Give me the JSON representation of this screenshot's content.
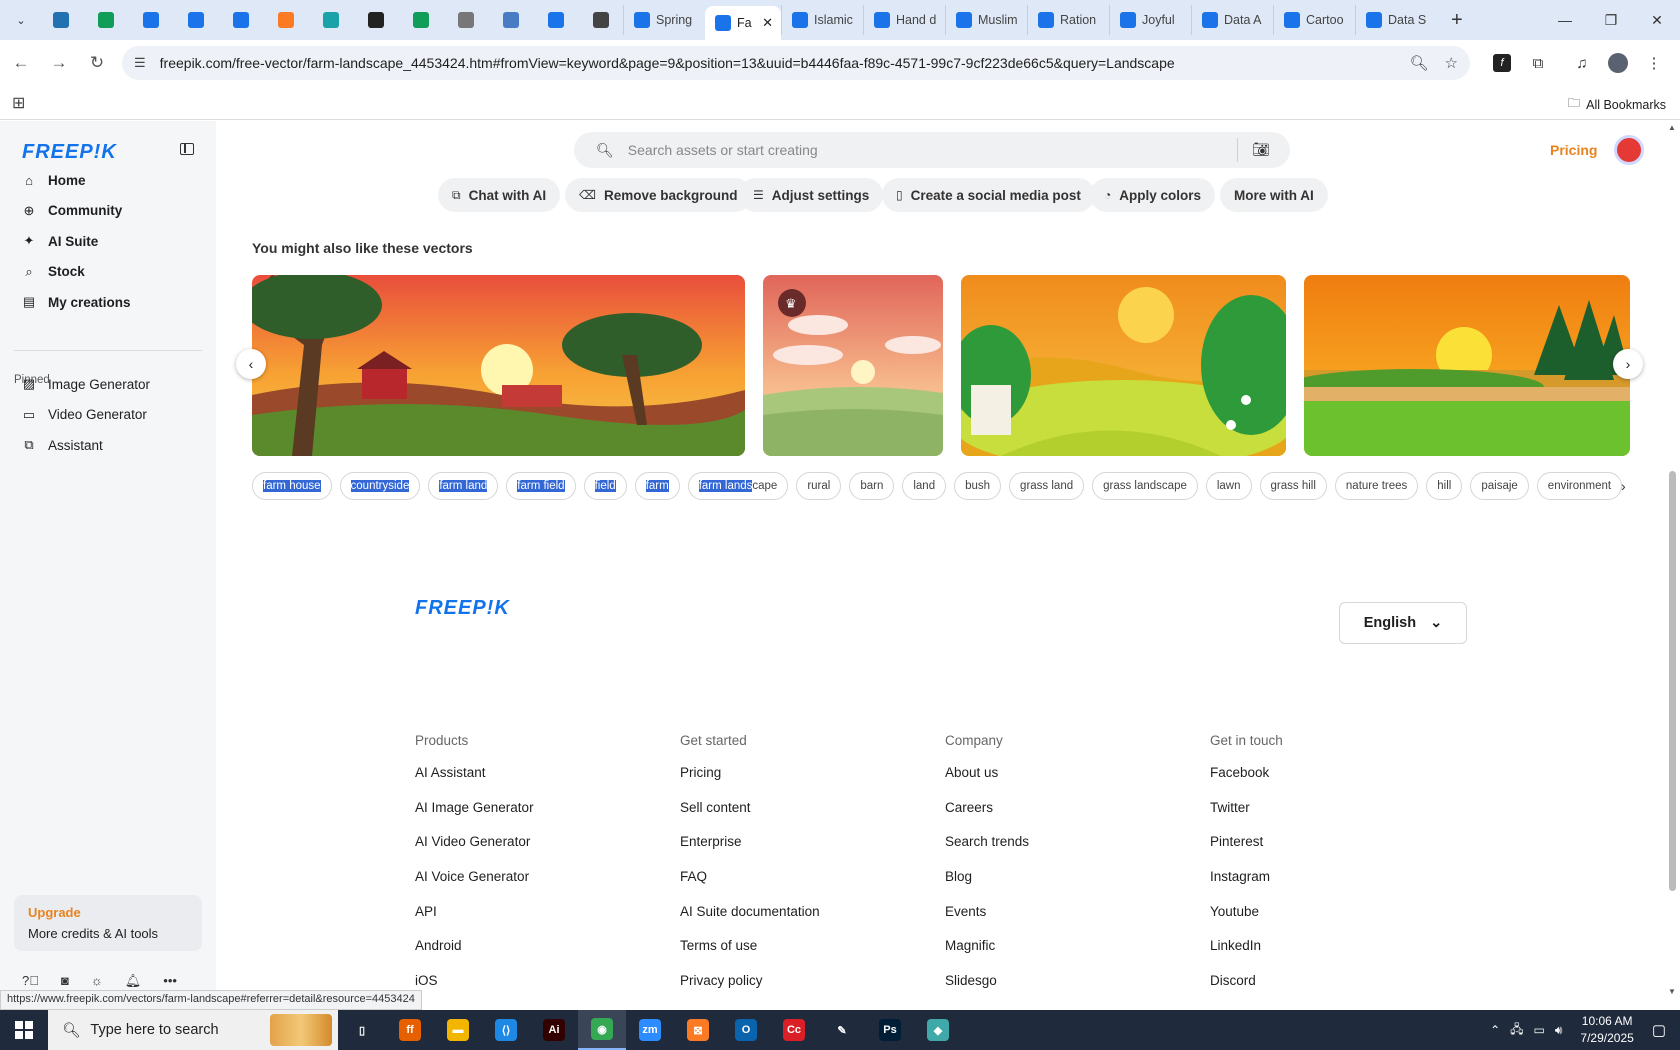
{
  "browser": {
    "pinned_tabs": [
      {
        "icon": "chevron-down-icon"
      },
      {
        "icon": "wordpress-icon",
        "color": "#2271b1"
      },
      {
        "icon": "sheets-icon",
        "color": "#0f9d58"
      },
      {
        "icon": "docs-icon",
        "color": "#1a73e8"
      },
      {
        "icon": "docs-icon",
        "color": "#1a73e8"
      },
      {
        "icon": "docs-icon",
        "color": "#1a73e8"
      },
      {
        "icon": "xampp-icon",
        "color": "#fb7a24"
      },
      {
        "icon": "teal-app-icon",
        "color": "#1aa2a8"
      },
      {
        "icon": "chatgpt-icon",
        "color": "#222222"
      },
      {
        "icon": "sheets-icon",
        "color": "#0f9d58"
      },
      {
        "icon": "globe-icon",
        "color": "#777777"
      },
      {
        "icon": "grid-app-icon",
        "color": "#4a7cc4"
      },
      {
        "icon": "docs-icon",
        "color": "#1a73e8"
      },
      {
        "icon": "speaker-icon",
        "color": "#444444"
      }
    ],
    "tabs": [
      {
        "label": "Spring",
        "active": false
      },
      {
        "label": "Fa",
        "active": true
      },
      {
        "label": "Islamic",
        "active": false
      },
      {
        "label": "Hand d",
        "active": false
      },
      {
        "label": "Muslim",
        "active": false
      },
      {
        "label": "Ration",
        "active": false
      },
      {
        "label": "Joyful",
        "active": false
      },
      {
        "label": "Data A",
        "active": false
      },
      {
        "label": "Cartoo",
        "active": false
      },
      {
        "label": "Data S",
        "active": false
      }
    ],
    "url": "freepik.com/free-vector/farm-landscape_4453424.htm#fromView=keyword&page=9&position=13&uuid=b4446faa-f89c-4571-99c7-9cf223de66c5&query=Landscape",
    "all_bookmarks": "All Bookmarks",
    "status_url": "https://www.freepik.com/vectors/farm-landscape#referrer=detail&resource=4453424"
  },
  "sidebar": {
    "logo": "FREEP!K",
    "items": [
      {
        "label": "Home",
        "icon": "home-icon"
      },
      {
        "label": "Community",
        "icon": "globe-icon"
      },
      {
        "label": "AI Suite",
        "icon": "sparkle-icon"
      },
      {
        "label": "Stock",
        "icon": "search-icon"
      },
      {
        "label": "My creations",
        "icon": "folder-icon"
      }
    ],
    "pinned_label": "Pinned",
    "pinned": [
      {
        "label": "Image Generator",
        "icon": "image-icon"
      },
      {
        "label": "Video Generator",
        "icon": "video-icon"
      },
      {
        "label": "Assistant",
        "icon": "assistant-icon"
      }
    ],
    "upgrade": {
      "title": "Upgrade",
      "subtitle": "More credits & AI tools"
    }
  },
  "header": {
    "search_placeholder": "Search assets or start creating",
    "pricing": "Pricing"
  },
  "ai_tools": [
    {
      "label": "Chat with AI",
      "icon": "chat-icon"
    },
    {
      "label": "Remove background",
      "icon": "eraser-icon"
    },
    {
      "label": "Adjust settings",
      "icon": "sliders-icon"
    },
    {
      "label": "Create a social media post",
      "icon": "phone-icon"
    },
    {
      "label": "Apply colors",
      "icon": "palette-icon"
    },
    {
      "label": "More with AI",
      "icon": ""
    }
  ],
  "related": {
    "heading": "You might also like these vectors"
  },
  "tags": [
    {
      "label": "farm house",
      "selected": true
    },
    {
      "label": "countryside",
      "selected": true
    },
    {
      "label": "farm land",
      "selected": true
    },
    {
      "label": "farm field",
      "selected": true
    },
    {
      "label": "field",
      "selected": true
    },
    {
      "label": "farm",
      "selected": true
    },
    {
      "label": "farm lands",
      "rest": "cape",
      "selected": true
    },
    {
      "label": "rural"
    },
    {
      "label": "barn"
    },
    {
      "label": "land"
    },
    {
      "label": "bush"
    },
    {
      "label": "grass land"
    },
    {
      "label": "grass landscape"
    },
    {
      "label": "lawn"
    },
    {
      "label": "grass hill"
    },
    {
      "label": "nature trees"
    },
    {
      "label": "hill"
    },
    {
      "label": "paisaje"
    },
    {
      "label": "environment"
    }
  ],
  "footer": {
    "logo": "FREEP!K",
    "language": "English",
    "columns": [
      {
        "heading": "Products",
        "links": [
          "AI Assistant",
          "AI Image Generator",
          "AI Video Generator",
          "AI Voice Generator",
          "API",
          "Android",
          "iOS"
        ]
      },
      {
        "heading": "Get started",
        "links": [
          "Pricing",
          "Sell content",
          "Enterprise",
          "FAQ",
          "AI Suite documentation",
          "Terms of use",
          "Privacy policy"
        ]
      },
      {
        "heading": "Company",
        "links": [
          "About us",
          "Careers",
          "Search trends",
          "Blog",
          "Events",
          "Magnific",
          "Slidesgo"
        ]
      },
      {
        "heading": "Get in touch",
        "links": [
          "Facebook",
          "Twitter",
          "Pinterest",
          "Instagram",
          "Youtube",
          "LinkedIn",
          "Discord"
        ]
      }
    ]
  },
  "taskbar": {
    "search_placeholder": "Type here to search",
    "apps": [
      {
        "icon": "task-view-icon",
        "color": "#1f2a3c",
        "text": "▯"
      },
      {
        "icon": "firefox-icon",
        "color": "#e66000",
        "text": "ff"
      },
      {
        "icon": "file-explorer-icon",
        "color": "#f2b600",
        "text": "▬"
      },
      {
        "icon": "vscode-icon",
        "color": "#1e88e5",
        "text": "⟨⟩"
      },
      {
        "icon": "illustrator-icon",
        "color": "#330000",
        "text": "Ai"
      },
      {
        "icon": "chrome-icon",
        "color": "#34a853",
        "text": "◉"
      },
      {
        "icon": "zoom-icon",
        "color": "#2d8cff",
        "text": "zm"
      },
      {
        "icon": "xampp-icon",
        "color": "#fb7a24",
        "text": "⊠"
      },
      {
        "icon": "outlook-icon",
        "color": "#0a64ad",
        "text": "O"
      },
      {
        "icon": "creative-cloud-icon",
        "color": "#da1f26",
        "text": "Cc"
      },
      {
        "icon": "pen-tool-icon",
        "color": "#1f2a3c",
        "text": "✎"
      },
      {
        "icon": "photoshop-icon",
        "color": "#001e36",
        "text": "Ps"
      },
      {
        "icon": "app-icon",
        "color": "#3fa9a9",
        "text": "◆"
      }
    ],
    "time": "10:06 AM",
    "date": "7/29/2025"
  }
}
